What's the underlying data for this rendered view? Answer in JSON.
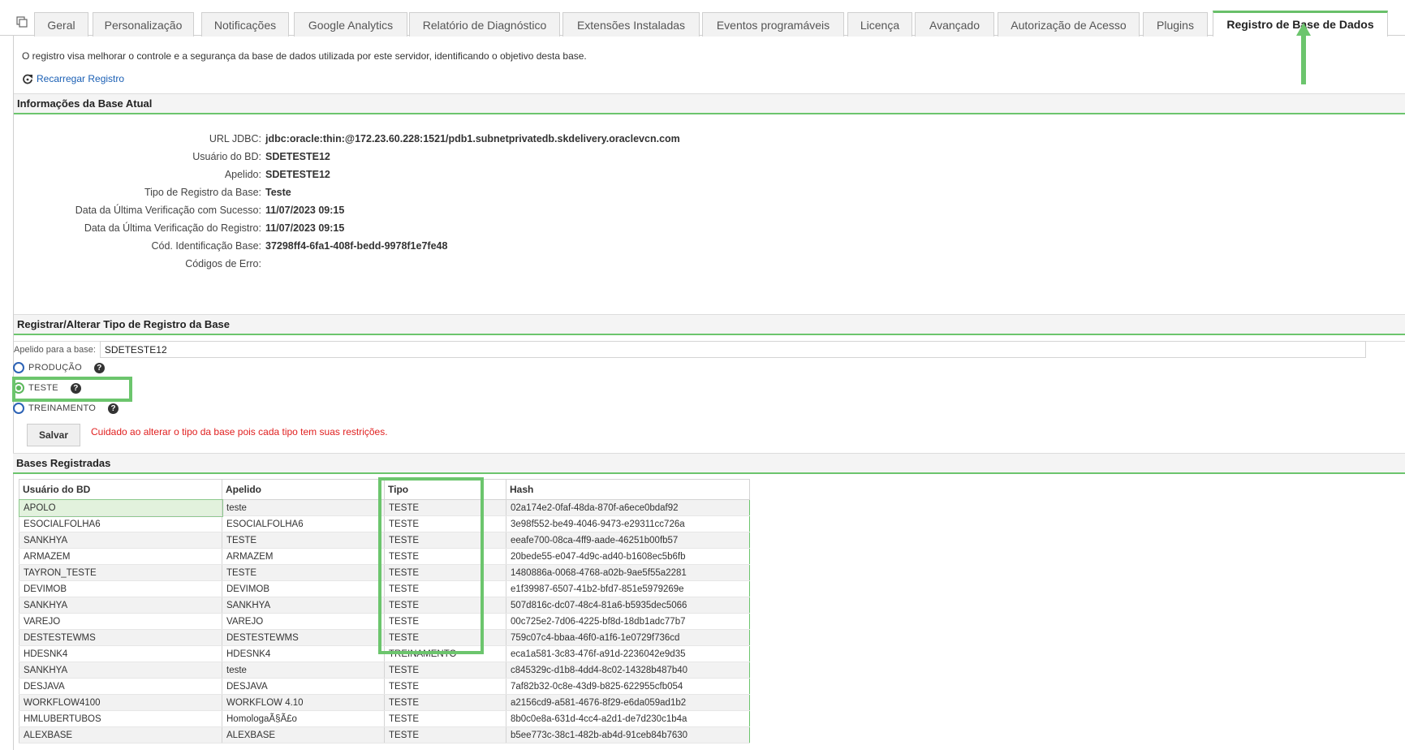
{
  "tabs": [
    {
      "label": "Geral"
    },
    {
      "label": "Personalização"
    },
    {
      "label": "Notificações"
    },
    {
      "label": "Google Analytics"
    },
    {
      "label": "Relatório de Diagnóstico"
    },
    {
      "label": "Extensões Instaladas"
    },
    {
      "label": "Eventos programáveis"
    },
    {
      "label": "Licença"
    },
    {
      "label": "Avançado"
    },
    {
      "label": "Autorização de Acesso"
    },
    {
      "label": "Plugins"
    },
    {
      "label": "Registro de Base de Dados",
      "active": true
    }
  ],
  "intro_text": "O registro visa melhorar o controle e a segurança da base de dados utilizada por este servidor, identificando o objetivo desta base.",
  "reload_label": "Recarregar Registro",
  "info_section": {
    "title": "Informações da Base Atual",
    "rows": [
      {
        "label": "URL JDBC:",
        "value": "jdbc:oracle:thin:@172.23.60.228:1521/pdb1.subnetprivatedb.skdelivery.oraclevcn.com"
      },
      {
        "label": "Usuário do BD:",
        "value": "SDETESTE12"
      },
      {
        "label": "Apelido:",
        "value": "SDETESTE12"
      },
      {
        "label": "Tipo de Registro da Base:",
        "value": "Teste"
      },
      {
        "label": "Data da Última Verificação com Sucesso:",
        "value": "11/07/2023 09:15"
      },
      {
        "label": "Data da Última Verificação do Registro:",
        "value": "11/07/2023 09:15"
      },
      {
        "label": "Cód. Identificação Base:",
        "value": "37298ff4-6fa1-408f-bedd-9978f1e7fe48"
      },
      {
        "label": "Códigos de Erro:",
        "value": ""
      }
    ]
  },
  "register_section": {
    "title": "Registrar/Alterar Tipo de Registro da Base",
    "alias_label": "Apelido para a base:",
    "alias_value": "SDETESTE12",
    "options": [
      {
        "label": "PRODUÇÃO",
        "checked": false
      },
      {
        "label": "TESTE",
        "checked": true
      },
      {
        "label": "TREINAMENTO",
        "checked": false
      }
    ],
    "help_glyph": "?",
    "save_label": "Salvar",
    "warning": "Cuidado ao alterar o tipo da base pois cada tipo tem suas restrições."
  },
  "bases_section": {
    "title": "Bases Registradas",
    "columns": [
      "Usuário do BD",
      "Apelido",
      "Tipo",
      "Hash"
    ],
    "rows": [
      [
        "APOLO",
        "teste",
        "TESTE",
        "02a174e2-0faf-48da-870f-a6ece0bdaf92"
      ],
      [
        "ESOCIALFOLHA6",
        "ESOCIALFOLHA6",
        "TESTE",
        "3e98f552-be49-4046-9473-e29311cc726a"
      ],
      [
        "SANKHYA",
        "TESTE",
        "TESTE",
        "eeafe700-08ca-4ff9-aade-46251b00fb57"
      ],
      [
        "ARMAZEM",
        "ARMAZEM",
        "TESTE",
        "20bede55-e047-4d9c-ad40-b1608ec5b6fb"
      ],
      [
        "TAYRON_TESTE",
        "TESTE",
        "TESTE",
        "1480886a-0068-4768-a02b-9ae5f55a2281"
      ],
      [
        "DEVIMOB",
        "DEVIMOB",
        "TESTE",
        "e1f39987-6507-41b2-bfd7-851e5979269e"
      ],
      [
        "SANKHYA",
        "SANKHYA",
        "TESTE",
        "507d816c-dc07-48c4-81a6-b5935dec5066"
      ],
      [
        "VAREJO",
        "VAREJO",
        "TESTE",
        "00c725e2-7d06-4225-bf8d-18db1adc77b7"
      ],
      [
        "DESTESTEWMS",
        "DESTESTEWMS",
        "TESTE",
        "759c07c4-bbaa-46f0-a1f6-1e0729f736cd"
      ],
      [
        "HDESNK4",
        "HDESNK4",
        "TREINAMENTO",
        "eca1a581-3c83-476f-a91d-2236042e9d35"
      ],
      [
        "SANKHYA",
        "teste",
        "TESTE",
        "c845329c-d1b8-4dd4-8c02-14328b487b40"
      ],
      [
        "DESJAVA",
        "DESJAVA",
        "TESTE",
        "7af82b32-0c8e-43d9-b825-622955cfb054"
      ],
      [
        "WORKFLOW4100",
        "WORKFLOW 4.10",
        "TESTE",
        "a2156cd9-a581-4676-8f29-e6da059ad1b2"
      ],
      [
        "HMLUBERTUBOS",
        "HomologaÃ§Ã£o",
        "TESTE",
        "8b0c0e8a-631d-4cc4-a2d1-de7d230c1b4a"
      ],
      [
        "ALEXBASE",
        "ALEXBASE",
        "TESTE",
        "b5ee773c-38c1-482b-ab4d-91ceb84b7630"
      ]
    ]
  },
  "colors": {
    "accent": "#6cc56d",
    "link": "#1a5fb4",
    "warning": "#e02020"
  }
}
